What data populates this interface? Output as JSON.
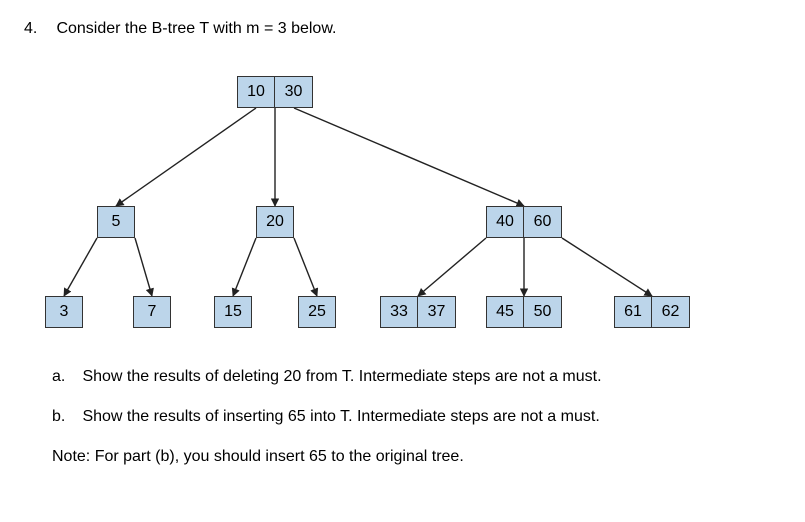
{
  "question": {
    "number": "4.",
    "prompt": "Consider the B-tree T with m = 3 below."
  },
  "tree": {
    "root": {
      "keys": [
        "10",
        "30"
      ]
    },
    "mid_l": {
      "keys": [
        "5"
      ]
    },
    "mid_c": {
      "keys": [
        "20"
      ]
    },
    "mid_r": {
      "keys": [
        "40",
        "60"
      ]
    },
    "leaf_3": {
      "keys": [
        "3"
      ]
    },
    "leaf_7": {
      "keys": [
        "7"
      ]
    },
    "leaf_15": {
      "keys": [
        "15"
      ]
    },
    "leaf_25": {
      "keys": [
        "25"
      ]
    },
    "leaf_3337": {
      "keys": [
        "33",
        "37"
      ]
    },
    "leaf_4550": {
      "keys": [
        "45",
        "50"
      ]
    },
    "leaf_6162": {
      "keys": [
        "61",
        "62"
      ]
    }
  },
  "parts": {
    "a_letter": "a.",
    "a_text": "Show the results of deleting 20 from T. Intermediate steps are not a must.",
    "b_letter": "b.",
    "b_text": "Show the results of inserting 65 into T. Intermediate steps are not a must.",
    "note": "Note: For part (b), you should insert 65 to the original tree."
  },
  "chart_data": {
    "type": "table",
    "description": "B-tree of order m=3",
    "nodes": [
      {
        "id": "root",
        "keys": [
          10,
          30
        ],
        "children": [
          "mid_l",
          "mid_c",
          "mid_r"
        ]
      },
      {
        "id": "mid_l",
        "keys": [
          5
        ],
        "children": [
          "leaf_3",
          "leaf_7"
        ]
      },
      {
        "id": "mid_c",
        "keys": [
          20
        ],
        "children": [
          "leaf_15",
          "leaf_25"
        ]
      },
      {
        "id": "mid_r",
        "keys": [
          40,
          60
        ],
        "children": [
          "leaf_3337",
          "leaf_4550",
          "leaf_6162"
        ]
      },
      {
        "id": "leaf_3",
        "keys": [
          3
        ]
      },
      {
        "id": "leaf_7",
        "keys": [
          7
        ]
      },
      {
        "id": "leaf_15",
        "keys": [
          15
        ]
      },
      {
        "id": "leaf_25",
        "keys": [
          25
        ]
      },
      {
        "id": "leaf_3337",
        "keys": [
          33,
          37
        ]
      },
      {
        "id": "leaf_4550",
        "keys": [
          45,
          50
        ]
      },
      {
        "id": "leaf_6162",
        "keys": [
          61,
          62
        ]
      }
    ]
  }
}
